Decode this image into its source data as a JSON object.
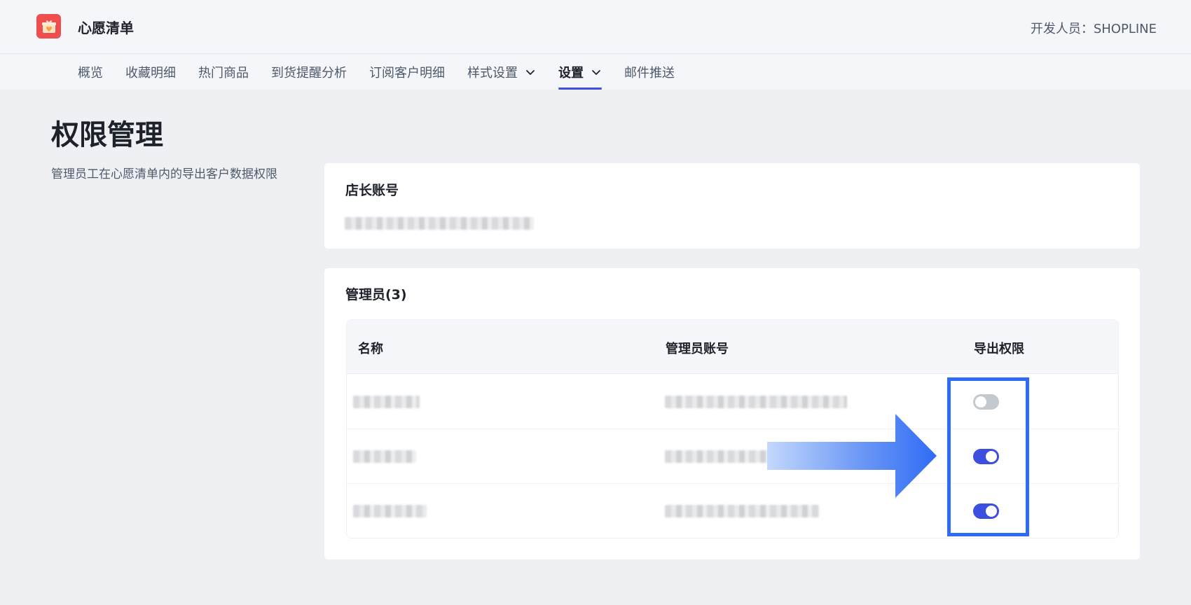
{
  "header": {
    "app_title": "心愿清单",
    "developer": "开发人员：SHOPLINE"
  },
  "nav": {
    "tabs": [
      {
        "label": "概览",
        "active": false
      },
      {
        "label": "收藏明细",
        "active": false
      },
      {
        "label": "热门商品",
        "active": false
      },
      {
        "label": "到货提醒分析",
        "active": false
      },
      {
        "label": "订阅客户明细",
        "active": false
      },
      {
        "label": "样式设置",
        "active": false,
        "dropdown": true
      },
      {
        "label": "设置",
        "active": true,
        "dropdown": true
      },
      {
        "label": "邮件推送",
        "active": false
      }
    ]
  },
  "page": {
    "title": "权限管理",
    "description": "管理员工在心愿清单内的导出客户数据权限"
  },
  "owner_card": {
    "title": "店长账号"
  },
  "admin_card": {
    "title": "管理员(3)",
    "columns": [
      "名称",
      "管理员账号",
      "导出权限"
    ],
    "rows": [
      {
        "export_permission": false
      },
      {
        "export_permission": true
      },
      {
        "export_permission": true
      }
    ]
  },
  "colors": {
    "accent": "#3c4fde",
    "highlight": "#2f6cf5",
    "logo": "#ee4e4e"
  }
}
